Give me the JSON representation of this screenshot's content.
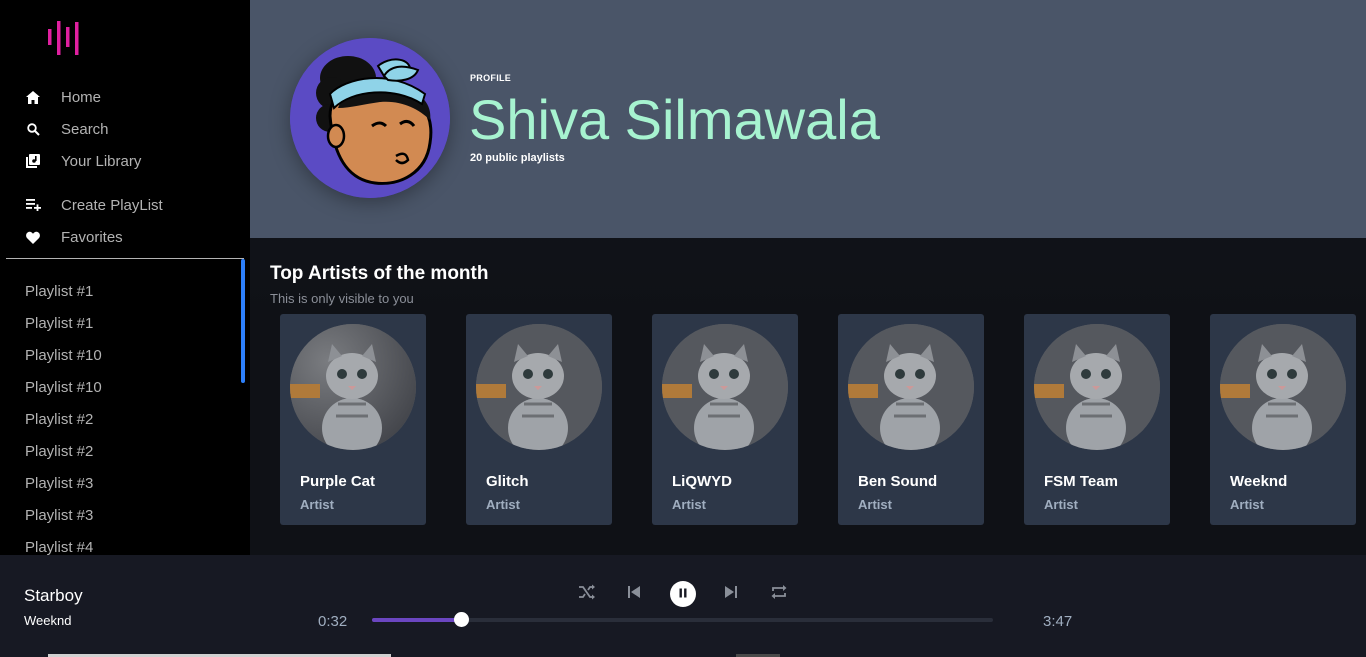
{
  "sidebar": {
    "logo_icon": "equalizer-bars-logo",
    "nav": [
      {
        "label": "Home",
        "icon": "home-icon"
      },
      {
        "label": "Search",
        "icon": "search-icon"
      },
      {
        "label": "Your Library",
        "icon": "library-icon"
      },
      {
        "label": "Create PlayList",
        "icon": "add-playlist-icon"
      },
      {
        "label": "Favorites",
        "icon": "heart-icon"
      }
    ],
    "playlists": [
      "Playlist #1",
      "Playlist #1",
      "Playlist #10",
      "Playlist #10",
      "Playlist #2",
      "Playlist #2",
      "Playlist #3",
      "Playlist #3",
      "Playlist #4"
    ]
  },
  "profile": {
    "label": "PROFILE",
    "name": "Shiva Silmawala",
    "subtitle": "20 public playlists"
  },
  "top_artists": {
    "title": "Top Artists of the month",
    "subtitle": "This is only visible to you",
    "items": [
      {
        "name": "Purple Cat",
        "kind": "Artist"
      },
      {
        "name": "Glitch",
        "kind": "Artist"
      },
      {
        "name": "LiQWYD",
        "kind": "Artist"
      },
      {
        "name": "Ben Sound",
        "kind": "Artist"
      },
      {
        "name": "FSM Team",
        "kind": "Artist"
      },
      {
        "name": "Weeknd",
        "kind": "Artist"
      }
    ]
  },
  "player": {
    "title": "Starboy",
    "artist": "Weeknd",
    "current_time": "0:32",
    "total_time": "3:47",
    "progress": 0.143
  },
  "colors": {
    "accent": "#6b46c1",
    "logo": "#e020a0",
    "profile_name": "#a7f3d0",
    "header_bg": "#4a5568",
    "card_bg": "#2d3748"
  }
}
